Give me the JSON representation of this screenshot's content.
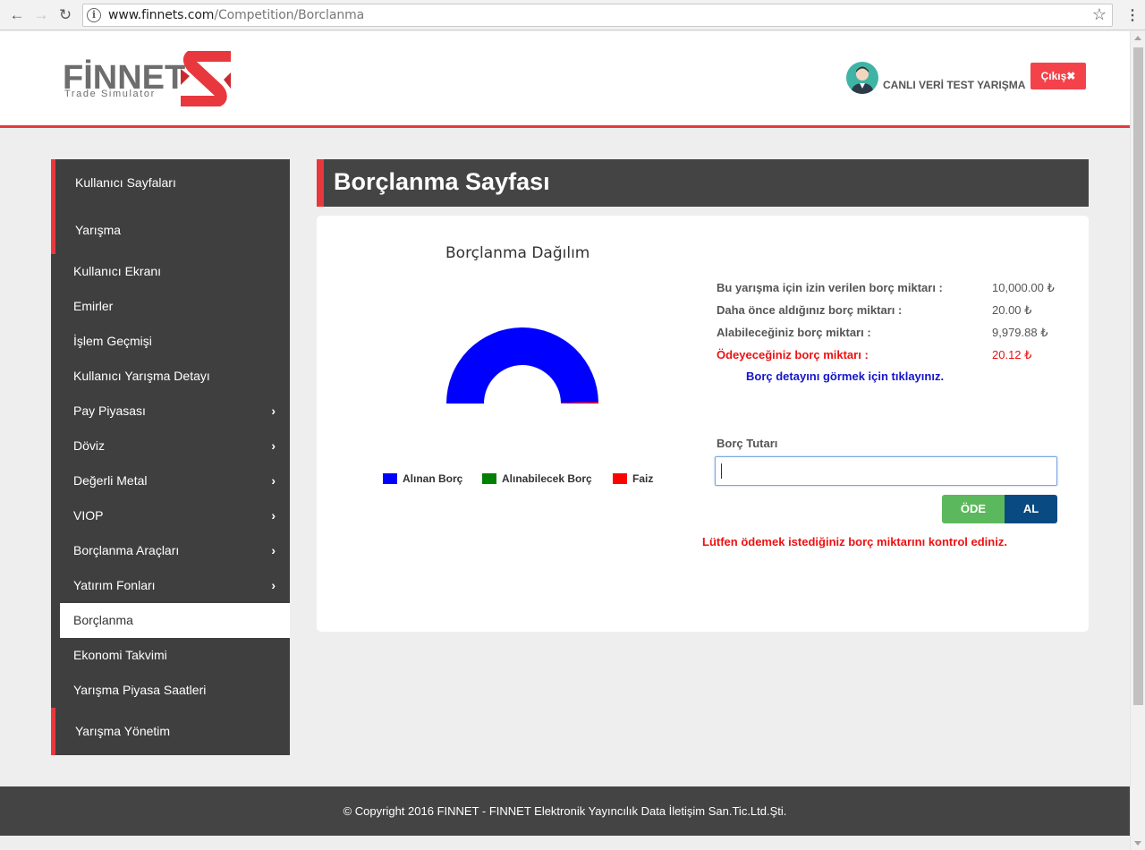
{
  "browser": {
    "url_host": "www.finnets.com",
    "url_path": "/Competition/Borclanma"
  },
  "header": {
    "logo_text": "FİNNET",
    "logo_sub": "Trade Simulator",
    "user_name": "CANLI VERİ TEST YARIŞMA",
    "logout_label": "Çıkış✖"
  },
  "sidebar": {
    "sections": [
      "Kullanıcı Sayfaları",
      "Yarışma",
      "Yarışma Yönetim"
    ],
    "items": [
      {
        "label": "Kullanıcı Ekranı"
      },
      {
        "label": "Emirler"
      },
      {
        "label": "İşlem Geçmişi"
      },
      {
        "label": "Kullanıcı Yarışma Detayı"
      },
      {
        "label": "Pay Piyasası"
      },
      {
        "label": "Döviz"
      },
      {
        "label": "Değerli Metal"
      },
      {
        "label": "VIOP"
      },
      {
        "label": "Borçlanma Araçları"
      },
      {
        "label": "Yatırım Fonları"
      },
      {
        "label": "Borçlanma"
      },
      {
        "label": "Ekonomi Takvimi"
      },
      {
        "label": "Yarışma Piyasa Saatleri"
      }
    ]
  },
  "page": {
    "title": "Borçlanma Sayfası"
  },
  "chart_data": {
    "type": "pie",
    "title": "Borçlanma Dağılım",
    "shape": "half-donut",
    "slices": [
      {
        "name": "Alınan Borç",
        "value": 20.0,
        "color": "#0000ff"
      },
      {
        "name": "Alınabilecek Borç",
        "value": 0,
        "color": "#008000"
      },
      {
        "name": "Faiz",
        "value": 0.12,
        "color": "#ff0000"
      }
    ],
    "legend_position": "bottom"
  },
  "info": {
    "rows": [
      {
        "label": "Bu yarışma için izin verilen borç miktarı :",
        "value": "10,000.00 ₺"
      },
      {
        "label": "Daha önce aldığınız borç miktarı :",
        "value": "20.00 ₺"
      },
      {
        "label": "Alabileceğiniz borç miktarı :",
        "value": "9,979.88 ₺"
      },
      {
        "label": "Ödeyeceğiniz borç miktarı :",
        "value": "20.12 ₺"
      }
    ],
    "detail_link": "Borç detayını görmek için tıklayınız."
  },
  "form": {
    "label": "Borç Tutarı",
    "value": "",
    "pay_label": "ÖDE",
    "take_label": "AL",
    "warning": "Lütfen ödemek istediğiniz borç miktarını kontrol ediniz."
  },
  "footer": {
    "copyright": "© Copyright 2016 FINNET - FINNET Elektronik Yayıncılık Data İletişim San.Tic.Ltd.Şti."
  },
  "colors": {
    "accent": "#e8383d",
    "sidebar_bg": "#3f3f3f",
    "success": "#5cb85c",
    "primary_dark": "#0a4a82"
  }
}
